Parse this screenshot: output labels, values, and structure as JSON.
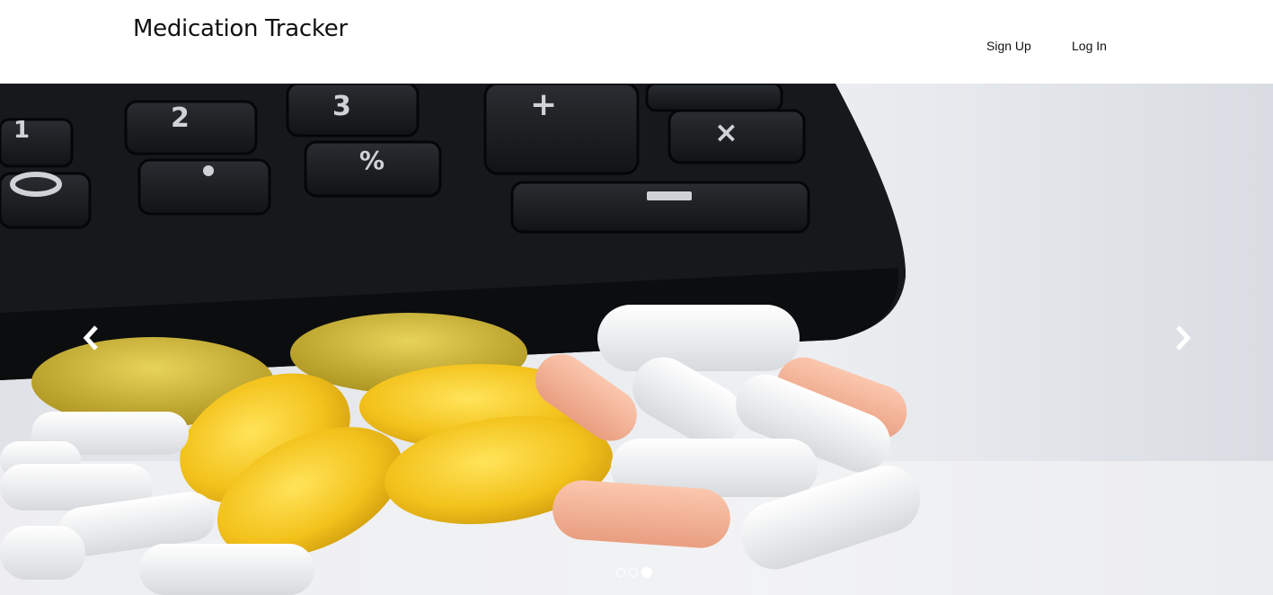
{
  "header": {
    "brand": "Medication Tracker",
    "nav": {
      "signup_label": "Sign Up",
      "login_label": "Log In"
    }
  },
  "carousel": {
    "slide_count": 3,
    "active_index": 2,
    "image_description": "pills-and-calculator-photo",
    "prev_icon": "chevron-left-icon",
    "next_icon": "chevron-right-icon"
  },
  "colors": {
    "header_bg": "#ffffff",
    "text": "#111111",
    "indicator": "#ffffff"
  }
}
